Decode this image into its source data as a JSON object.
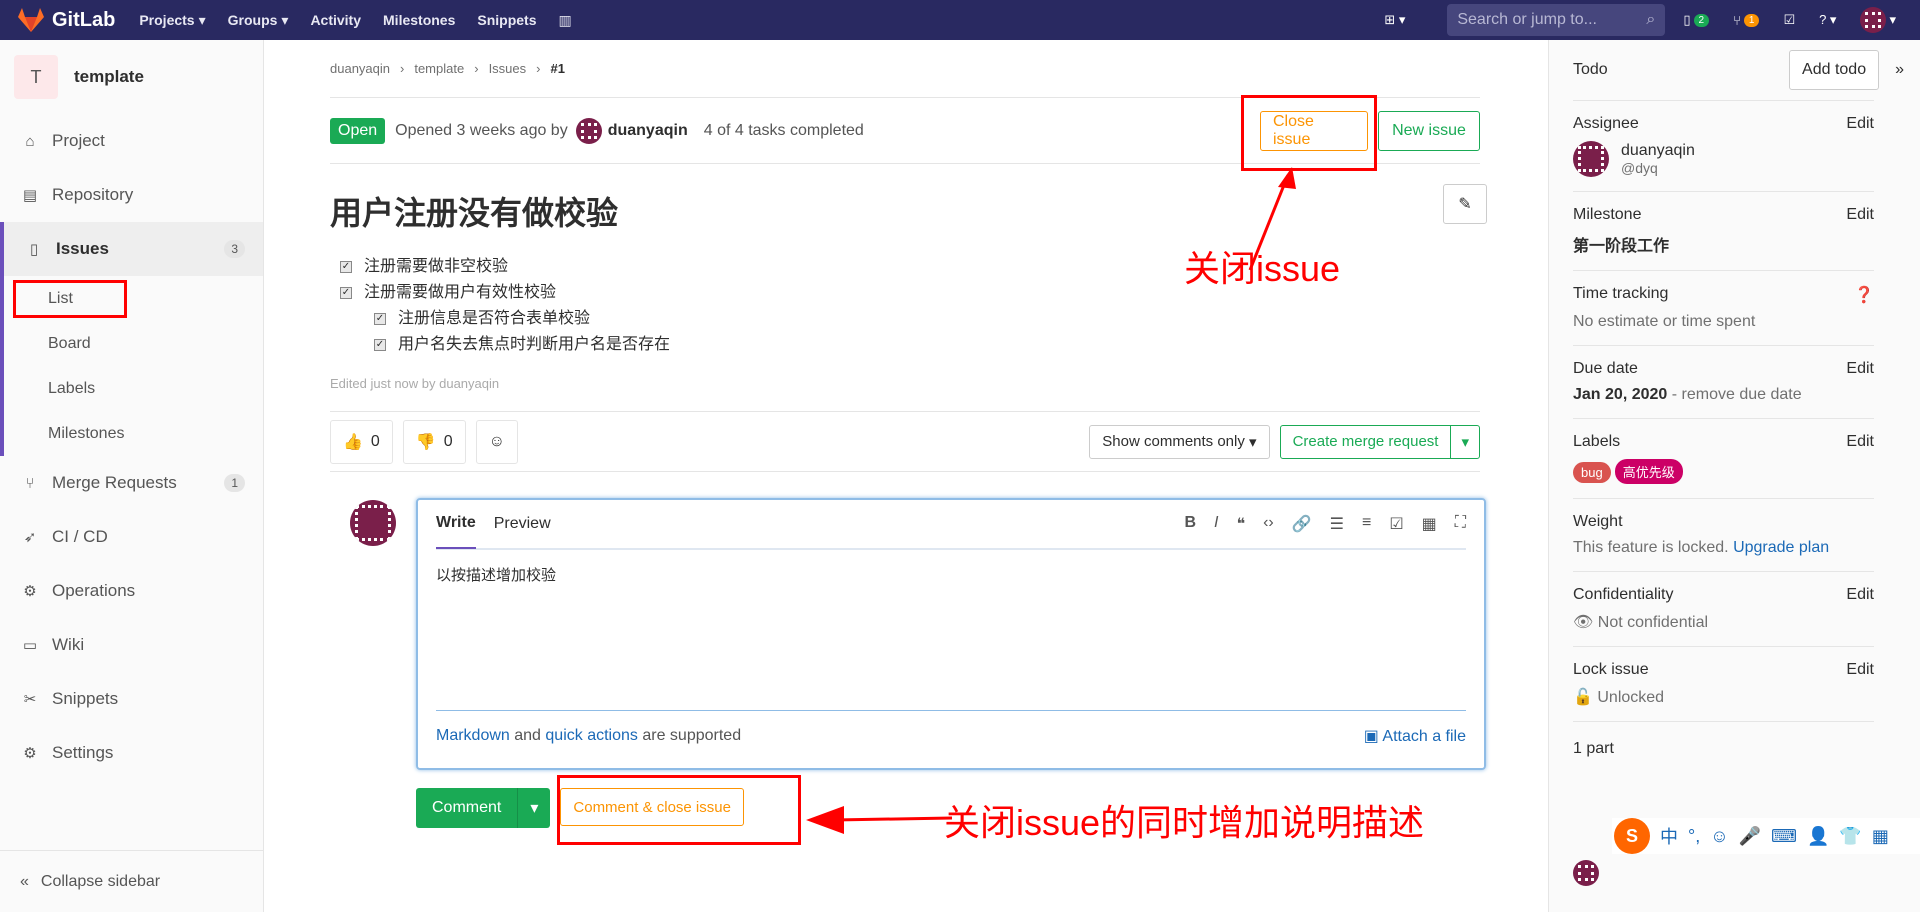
{
  "topbar": {
    "logo": "GitLab",
    "nav": [
      "Projects",
      "Groups",
      "Activity",
      "Milestones",
      "Snippets"
    ],
    "search_placeholder": "Search or jump to...",
    "issues_count": "2",
    "mr_count": "1"
  },
  "sidebar": {
    "project_initial": "T",
    "project_name": "template",
    "items": [
      {
        "label": "Project"
      },
      {
        "label": "Repository"
      },
      {
        "label": "Issues",
        "count": "3"
      },
      {
        "label": "Merge Requests",
        "count": "1"
      },
      {
        "label": "CI / CD"
      },
      {
        "label": "Operations"
      },
      {
        "label": "Wiki"
      },
      {
        "label": "Snippets"
      },
      {
        "label": "Settings"
      }
    ],
    "sub_items": [
      "List",
      "Board",
      "Labels",
      "Milestones"
    ],
    "collapse": "Collapse sidebar"
  },
  "crumbs": [
    "duanyaqin",
    "template",
    "Issues",
    "#1"
  ],
  "issue": {
    "status": "Open",
    "opened": "Opened 3 weeks ago by",
    "author": "duanyaqin",
    "tasks_status": "4 of 4 tasks completed",
    "close_btn": "Close issue",
    "new_btn": "New issue",
    "title": "用户注册没有做校验",
    "tasks": [
      "注册需要做非空校验",
      "注册需要做用户有效性校验"
    ],
    "subtasks": [
      "注册信息是否符合表单校验",
      "用户名失去焦点时判断用户名是否存在"
    ],
    "edited": "Edited just now by duanyaqin"
  },
  "awards": {
    "up": "0",
    "down": "0",
    "filter": "Show comments only",
    "mr_btn": "Create merge request"
  },
  "editor": {
    "tab_write": "Write",
    "tab_preview": "Preview",
    "text": "以按描述增加校验",
    "md": "Markdown",
    "and": " and ",
    "qa": "quick actions",
    "supported": " are supported",
    "attach": "Attach a file"
  },
  "actions": {
    "comment": "Comment",
    "close_comment": "Comment & close issue"
  },
  "annotations": {
    "close": "关闭issue",
    "close_desc": "关闭issue的同时增加说明描述"
  },
  "right": {
    "todo": "Todo",
    "add_todo": "Add todo",
    "assignee_h": "Assignee",
    "edit": "Edit",
    "assignee": "duanyaqin",
    "assignee_handle": "@dyq",
    "milestone_h": "Milestone",
    "milestone": "第一阶段工作",
    "time_h": "Time tracking",
    "time": "No estimate or time spent",
    "due_h": "Due date",
    "due": "Jan 20, 2020",
    "due_remove": " - remove due date",
    "labels_h": "Labels",
    "labels": [
      {
        "name": "bug",
        "color": "#d9534f"
      },
      {
        "name": "高优先级",
        "color": "#cc0066"
      }
    ],
    "weight_h": "Weight",
    "weight_locked": "This feature is locked.",
    "upgrade": "Upgrade plan",
    "conf_h": "Confidentiality",
    "conf": "Not confidential",
    "lock_h": "Lock issue",
    "lock": "Unlocked",
    "participants": "1 part"
  }
}
